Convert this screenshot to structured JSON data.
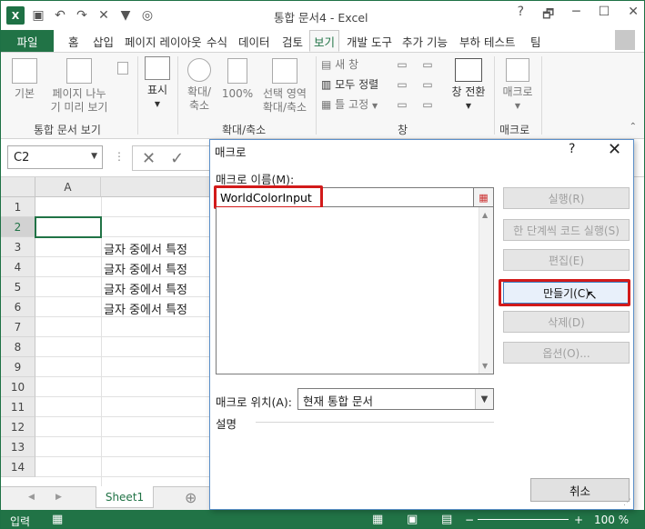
{
  "app": {
    "title": "통합 문서4 - Excel",
    "icons": [
      "excel-logo",
      "save-icon",
      "undo-icon",
      "redo-icon",
      "close-icon",
      "filter-icon",
      "record-icon"
    ]
  },
  "window_controls": {
    "help": "?",
    "restore": "🗗",
    "minimize": "─",
    "maximize": "☐",
    "close": "✕"
  },
  "tabs": [
    {
      "label": "파일"
    },
    {
      "label": "홈"
    },
    {
      "label": "삽입"
    },
    {
      "label": "페이지 레이아웃"
    },
    {
      "label": "수식"
    },
    {
      "label": "데이터"
    },
    {
      "label": "검토"
    },
    {
      "label": "보기"
    },
    {
      "label": "개발 도구"
    },
    {
      "label": "추가 기능"
    },
    {
      "label": "부하 테스트"
    },
    {
      "label": "팀"
    }
  ],
  "ribbon": {
    "normal": "기본",
    "pagebreak_l1": "페이지 나누",
    "pagebreak_l2": "기 미리 보기",
    "show": "표시",
    "zoom_l1": "확대/",
    "zoom_l2": "축소",
    "zoom100": "100%",
    "zoomsel_l1": "선택 영역",
    "zoomsel_l2": "확대/축소",
    "newwin": "새 창",
    "arrange": "모두 정렬",
    "freeze": "틀 고정",
    "switch": "창 전환",
    "macro": "매크로",
    "group_views": "통합 문서 보기",
    "group_zoom": "확대/축소",
    "group_window": "창",
    "group_macro": "매크로"
  },
  "formula": {
    "namebox": "C2",
    "cancel": "✕",
    "enter": "✓"
  },
  "grid": {
    "col_a": "A",
    "rows": [
      "1",
      "2",
      "3",
      "4",
      "5",
      "6",
      "7",
      "8",
      "9",
      "10",
      "11",
      "12",
      "13",
      "14"
    ],
    "cell_text": "글자 중에서 특정"
  },
  "sheets": {
    "tab": "Sheet1",
    "add": "⊕"
  },
  "status": {
    "mode": "입력",
    "zoom": "100 %"
  },
  "dialog": {
    "title": "매크로",
    "help": "?",
    "close": "✕",
    "name_label": "매크로 이름(M):",
    "name_value": "WorldColorInput",
    "buttons": {
      "run": "실행(R)",
      "step": "한 단계씩 코드 실행(S)",
      "edit": "편집(E)",
      "create": "만들기(C)",
      "delete": "삭제(D)",
      "options": "옵션(O)..."
    },
    "location_label": "매크로 위치(A):",
    "location_value": "현재 통합 문서",
    "description_label": "설명",
    "cancel": "취소"
  },
  "colors": {
    "accent": "#217346",
    "highlight": "#d21a1a"
  }
}
